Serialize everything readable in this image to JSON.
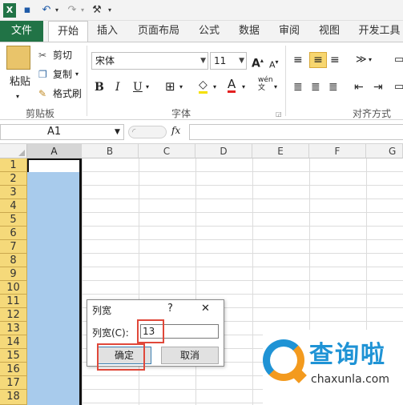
{
  "qat": {
    "excel_glyph": "X",
    "save_glyph": "▪",
    "undo_glyph": "↶",
    "redo_glyph": "↷",
    "customize_glyph": "⚒"
  },
  "tabs": [
    "文件",
    "开始",
    "插入",
    "页面布局",
    "公式",
    "数据",
    "审阅",
    "视图",
    "开发工具"
  ],
  "clipboard": {
    "paste": "粘贴",
    "cut": "剪切",
    "copy": "复制",
    "format_painter": "格式刷",
    "group_label": "剪贴板"
  },
  "font": {
    "name": "宋体",
    "size": "11",
    "grow": "A",
    "shrink": "A",
    "bold": "B",
    "italic": "I",
    "underline": "U",
    "wen": "wén",
    "group_label": "字体"
  },
  "alignment": {
    "group_label": "对齐方式"
  },
  "formula_bar": {
    "name_box": "A1",
    "fx": "fx"
  },
  "columns": [
    "A",
    "B",
    "C",
    "D",
    "E",
    "F",
    "G"
  ],
  "rows": [
    "1",
    "2",
    "3",
    "4",
    "5",
    "6",
    "7",
    "8",
    "9",
    "10",
    "11",
    "12",
    "13",
    "14",
    "15",
    "16",
    "17",
    "18"
  ],
  "dialog": {
    "title": "列宽",
    "help": "?",
    "close": "✕",
    "field_label": "列宽(C):",
    "value": "13",
    "ok": "确定",
    "cancel": "取消"
  },
  "watermark": {
    "brand": "查询啦",
    "domain": "chaxunla.com"
  },
  "colors": {
    "file_tab": "#217346",
    "selected_column": "#a8cbec",
    "row_header": "#f5d97a",
    "highlight_box": "#e0483a",
    "brand_orange": "#f39a1e",
    "brand_blue": "#1f93d5"
  }
}
